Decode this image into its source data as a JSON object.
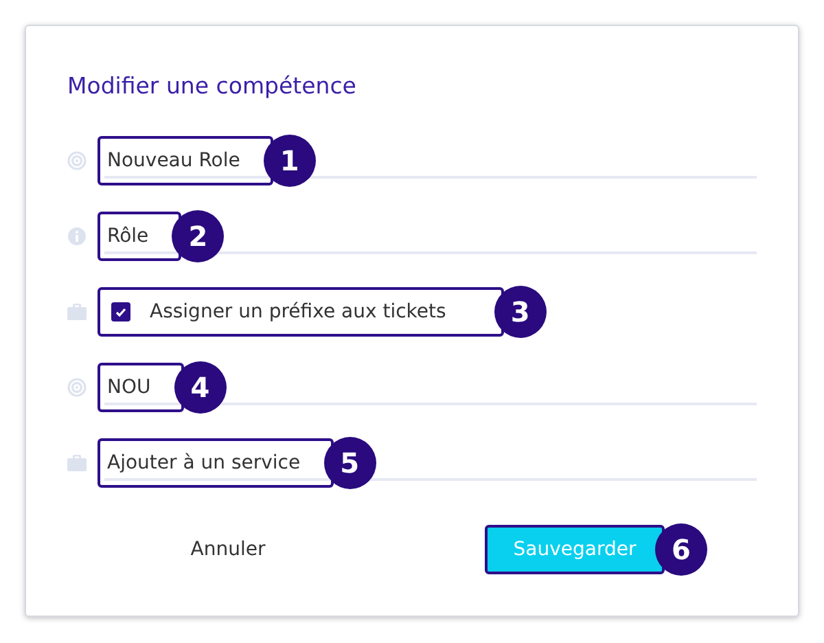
{
  "dialog": {
    "title": "Modifier une compétence",
    "fields": [
      {
        "kind": "text",
        "value": "Nouveau Role",
        "annotation": "1"
      },
      {
        "kind": "text",
        "value": "Rôle",
        "annotation": "2"
      },
      {
        "kind": "checkbox",
        "label": "Assigner un préfixe aux tickets",
        "checked": true,
        "annotation": "3"
      },
      {
        "kind": "text",
        "value": "NOU",
        "annotation": "4"
      },
      {
        "kind": "text",
        "value": "Ajouter à un service",
        "annotation": "5"
      }
    ],
    "buttons": [
      {
        "kind": "secondary",
        "label": "Annuler"
      },
      {
        "kind": "primary",
        "label": "Sauvegarder",
        "annotation": "6"
      }
    ]
  }
}
